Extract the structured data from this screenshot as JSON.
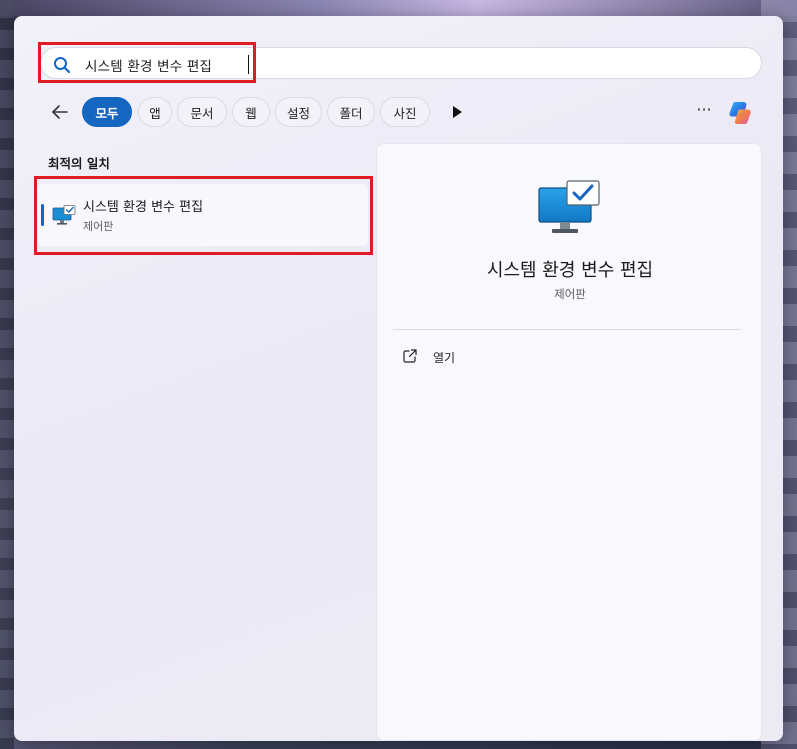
{
  "search": {
    "query": "시스템 환경 변수 편집",
    "icon": "search-icon"
  },
  "filters": {
    "back_icon": "back-arrow-icon",
    "chips": [
      {
        "label": "모두",
        "active": true
      },
      {
        "label": "앱",
        "active": false
      },
      {
        "label": "문서",
        "active": false
      },
      {
        "label": "웹",
        "active": false
      },
      {
        "label": "설정",
        "active": false
      },
      {
        "label": "폴더",
        "active": false
      },
      {
        "label": "사진",
        "active": false
      }
    ],
    "more_label": "···",
    "accent_color": "#1566c0"
  },
  "best_match": {
    "section_title": "최적의 일치",
    "item": {
      "title": "시스템 환경 변수 편집",
      "subtitle": "제어판",
      "icon": "monitor-check-icon"
    }
  },
  "detail": {
    "title": "시스템 환경 변수 편집",
    "subtitle": "제어판",
    "icon": "monitor-check-icon",
    "actions": [
      {
        "label": "열기",
        "icon": "open-external-icon"
      }
    ]
  },
  "annotations": {
    "highlight_color": "#e01b24"
  }
}
